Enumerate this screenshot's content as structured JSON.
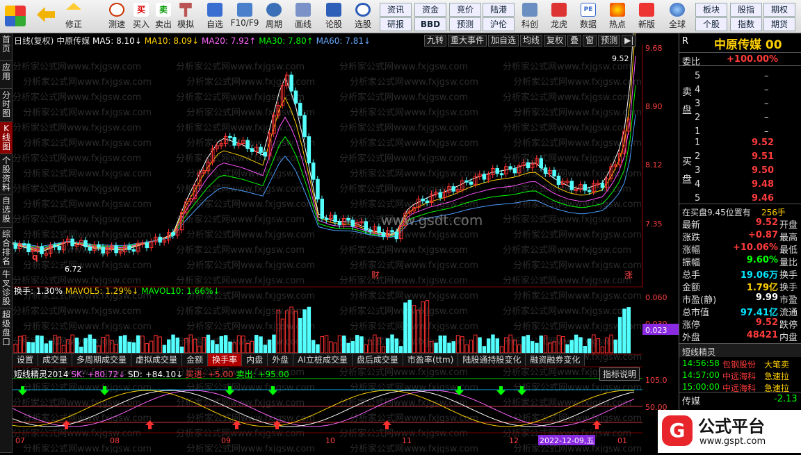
{
  "toolbar": {
    "items": [
      {
        "label": "修正",
        "icon": "refresh-icon"
      },
      {
        "label": "测速",
        "icon": "clock-icon"
      },
      {
        "label": "买入",
        "icon": "buy-icon"
      },
      {
        "label": "卖出",
        "icon": "sell-icon"
      },
      {
        "label": "模拟",
        "icon": "hammer-icon"
      },
      {
        "label": "自选",
        "icon": "star-icon"
      },
      {
        "label": "F10/F9",
        "icon": "f10-icon"
      },
      {
        "label": "周期",
        "icon": "period-icon"
      },
      {
        "label": "画线",
        "icon": "pencil-icon"
      },
      {
        "label": "论股",
        "icon": "chat-icon"
      },
      {
        "label": "选股",
        "icon": "screen-icon"
      },
      {
        "label": "科创",
        "icon": "kc-icon"
      },
      {
        "label": "龙虎",
        "icon": "lh-icon"
      },
      {
        "label": "数据",
        "icon": "pe-icon"
      },
      {
        "label": "热点",
        "icon": "hot-icon"
      },
      {
        "label": "新版",
        "icon": "new-icon"
      },
      {
        "label": "全球",
        "icon": "globe-icon"
      }
    ],
    "grid_buttons": [
      "资讯",
      "资金",
      "竞价",
      "陆港",
      "研报",
      "BBD",
      "预测",
      "沪伦"
    ],
    "right_buttons": [
      "板块",
      "股指",
      "期权",
      "个股",
      "指数",
      "期货"
    ]
  },
  "left_nav": [
    "首页",
    "应用",
    "分时图",
    "K线图",
    "个股资料",
    "自选股",
    "综合排名",
    "牛叉诊股",
    "超级盘口"
  ],
  "chart": {
    "info": {
      "period": "日线(复权)",
      "name": "中原传媒",
      "ma5": "MA5: 8.10↓",
      "ma10": "MA10: 8.09↓",
      "ma20": "MA20: 7.92↑",
      "ma30": "MA30: 7.80↑",
      "ma60": "MA60: 7.81↓"
    },
    "top_buttons": [
      "九转",
      "重大事件",
      "加自选",
      "均线",
      "复权",
      "叠",
      "窗",
      "预测"
    ],
    "price_ticks": [
      "9.68",
      "8.90",
      "8.12",
      "7.35"
    ],
    "high_label": "9.52",
    "low_label": "6.72",
    "markers": [
      "q",
      "财",
      "涨"
    ],
    "watermark": "www.gsdt.com"
  },
  "volume": {
    "label": "换手: 1.30%",
    "mavol5": "MAVOL5: 1.29%↓",
    "mavol10": "MAVOL10: 1.66%↓",
    "ticks": [
      "0.060",
      "0.030"
    ],
    "current": "0.023"
  },
  "tabs": [
    "设置",
    "成交量",
    "多周期成交量",
    "虚拟成交量",
    "金额",
    "换手率",
    "内盘",
    "外盘",
    "AI立桩成交量",
    "盘后成交量",
    "市盈率(ttm)",
    "陆股通持股变化",
    "融资融券变化"
  ],
  "indicator": {
    "name": "短线精灵2014",
    "sk": "SK: +80.72↓",
    "sd": "SD: +84.10↓",
    "buy": "买进: +5.00",
    "sell": "卖出: +95.00",
    "help": "指标说明",
    "ticks": [
      "105.0",
      "50.00"
    ]
  },
  "xaxis": {
    "months": [
      "07",
      "08",
      "09",
      "10",
      "11",
      "12",
      "01"
    ],
    "cursor_date": "2022-12-09,五"
  },
  "quote": {
    "code": "R",
    "name": "中原传媒 00",
    "weibi_label": "委比",
    "weibi": "+100.00%",
    "sell_label": "卖盘",
    "buy_label": "买盘",
    "asks": [
      {
        "lvl": "5",
        "px": "–"
      },
      {
        "lvl": "4",
        "px": "–"
      },
      {
        "lvl": "3",
        "px": "–"
      },
      {
        "lvl": "2",
        "px": "–"
      },
      {
        "lvl": "1",
        "px": "–"
      }
    ],
    "bids": [
      {
        "lvl": "1",
        "px": "9.52"
      },
      {
        "lvl": "2",
        "px": "9.51"
      },
      {
        "lvl": "3",
        "px": "9.50"
      },
      {
        "lvl": "4",
        "px": "9.48"
      },
      {
        "lvl": "5",
        "px": "9.46"
      }
    ],
    "queue": "在买盘9.45位置有",
    "queue_vol": "256手",
    "stats": [
      {
        "k": "最新",
        "v": "9.52",
        "k2": "开盘"
      },
      {
        "k": "涨跌",
        "v": "+0.87",
        "k2": "最高"
      },
      {
        "k": "涨幅",
        "v": "+10.06%",
        "k2": "最低"
      },
      {
        "k": "振幅",
        "v": "9.60%",
        "k2": "量比"
      },
      {
        "k": "总手",
        "v": "19.06万",
        "k2": "换手"
      },
      {
        "k": "金额",
        "v": "1.79亿",
        "k2": "换手"
      },
      {
        "k": "市盈(静)",
        "v": "9.99",
        "k2": "市盈"
      },
      {
        "k": "总市值",
        "v": "97.41亿",
        "k2": "流通"
      },
      {
        "k": "涨停",
        "v": "9.52",
        "k2": "跌停"
      },
      {
        "k": "外盘",
        "v": "48421",
        "k2": "内盘"
      }
    ],
    "sprite_title": "短线精灵",
    "sprites": [
      {
        "t": "14:56:58",
        "n": "包钢股份",
        "e": "大笔卖"
      },
      {
        "t": "14:57:00",
        "n": "中远海科",
        "e": "急速拉"
      },
      {
        "t": "15:00:00",
        "n": "中远海科",
        "e": "急速拉"
      }
    ],
    "sector": "传媒",
    "sector_chg": "-2.13"
  },
  "logo": {
    "text": "公式平台",
    "url": "www.gspt.com"
  }
}
